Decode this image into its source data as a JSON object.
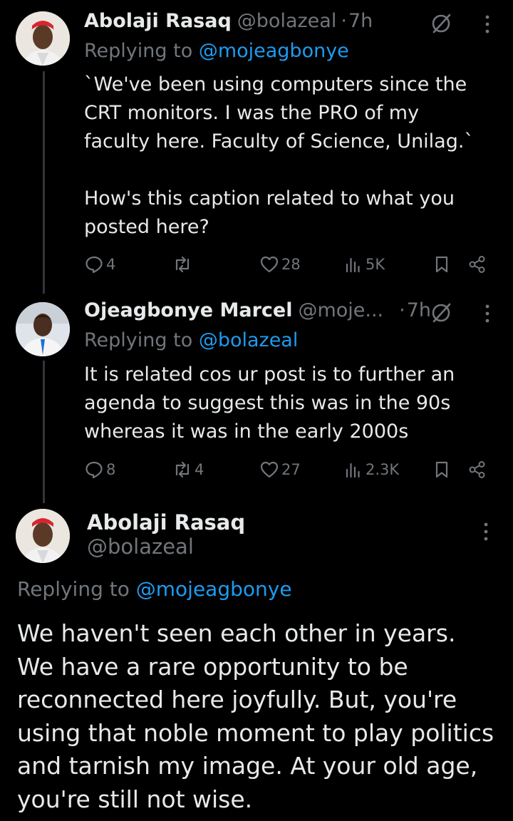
{
  "tweets": [
    {
      "name": "Abolaji Rasaq",
      "handle": "@bolazeal",
      "separator": "·",
      "time": "7h",
      "replying_prefix": "Replying to",
      "replying_to": "@mojeagbonye",
      "text": "`We've been using computers since the\nCRT monitors. I was the PRO of my\nfaculty here. Faculty of Science, Unilag.`\n\nHow's this caption related to what you\nposted here?",
      "replies": "4",
      "reposts": "",
      "likes": "28",
      "views": "5K"
    },
    {
      "name": "Ojeagbonye Marcel",
      "handle": "@moje...",
      "separator": "·",
      "time": "7h",
      "replying_prefix": "Replying to",
      "replying_to": "@bolazeal",
      "text": "It is related cos ur post is to further an\nagenda to suggest this was in the 90s\nwhereas it was in the early 2000s",
      "replies": "8",
      "reposts": "4",
      "likes": "27",
      "views": "2.3K"
    }
  ],
  "main_tweet": {
    "name": "Abolaji Rasaq",
    "handle": "@bolazeal",
    "replying_prefix": "Replying to",
    "replying_to": "@mojeagbonye",
    "text": "We haven't seen each other in years.\nWe have a rare opportunity to be\nreconnected here joyfully. But, you're\nusing that noble moment to play politics\nand tarnish my image. At your old age,\nyou're still not wise."
  },
  "colors": {
    "background": "#000000",
    "text_primary": "#e7e9ea",
    "text_secondary": "#71767b",
    "accent": "#1d9bf0",
    "thread_line": "#333639"
  },
  "icons": [
    "reply-icon",
    "repost-icon",
    "like-icon",
    "views-icon",
    "bookmark-icon",
    "share-icon",
    "grok-icon",
    "more-icon"
  ]
}
